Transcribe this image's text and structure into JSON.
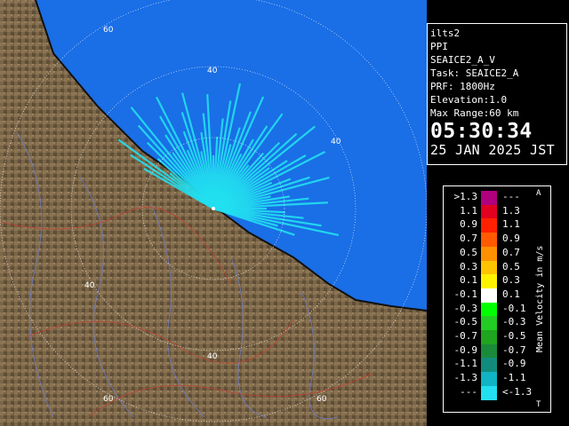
{
  "map": {
    "range_labels": [
      "60",
      "40",
      "40",
      "40",
      "40",
      "60",
      "60"
    ],
    "colors": {
      "sea": "#1a6ee6",
      "land": "#7a6547",
      "echo": "#22e0f0",
      "coast": "#111111"
    }
  },
  "info": {
    "site": "ilts2",
    "mode": "PPI",
    "product": "SEAICE2_A_V",
    "task": "Task: SEAICE2_A",
    "prf": "PRF: 1800Hz",
    "elevation": "Elevation:1.0",
    "max_range": "Max Range:60 km",
    "time": "05:30:34",
    "date": "25 JAN 2025 JST"
  },
  "legend": {
    "title": "Mean Velocity in m/s",
    "corner_top": "A",
    "corner_bottom": "T",
    "rows": [
      {
        "left": ">1.3",
        "right": "---",
        "color": "#b0007e"
      },
      {
        "left": "1.1",
        "right": "1.3",
        "color": "#e00020"
      },
      {
        "left": "0.9",
        "right": "1.1",
        "color": "#ff2000"
      },
      {
        "left": "0.7",
        "right": "0.9",
        "color": "#ff5a00"
      },
      {
        "left": "0.5",
        "right": "0.7",
        "color": "#ff9000"
      },
      {
        "left": "0.3",
        "right": "0.5",
        "color": "#ffc400"
      },
      {
        "left": "0.1",
        "right": "0.3",
        "color": "#fff200"
      },
      {
        "left": "-0.1",
        "right": "0.1",
        "color": "#ffffff"
      },
      {
        "left": "-0.3",
        "right": "-0.1",
        "color": "#00ff00"
      },
      {
        "left": "-0.5",
        "right": "-0.3",
        "color": "#22cc22"
      },
      {
        "left": "-0.7",
        "right": "-0.5",
        "color": "#1fa41f"
      },
      {
        "left": "-0.9",
        "right": "-0.7",
        "color": "#1a8a3a"
      },
      {
        "left": "-1.1",
        "right": "-0.9",
        "color": "#118c7c"
      },
      {
        "left": "-1.3",
        "right": "-1.1",
        "color": "#10b4c4"
      },
      {
        "left": "---",
        "right": "<-1.3",
        "color": "#22e0f0"
      }
    ]
  }
}
